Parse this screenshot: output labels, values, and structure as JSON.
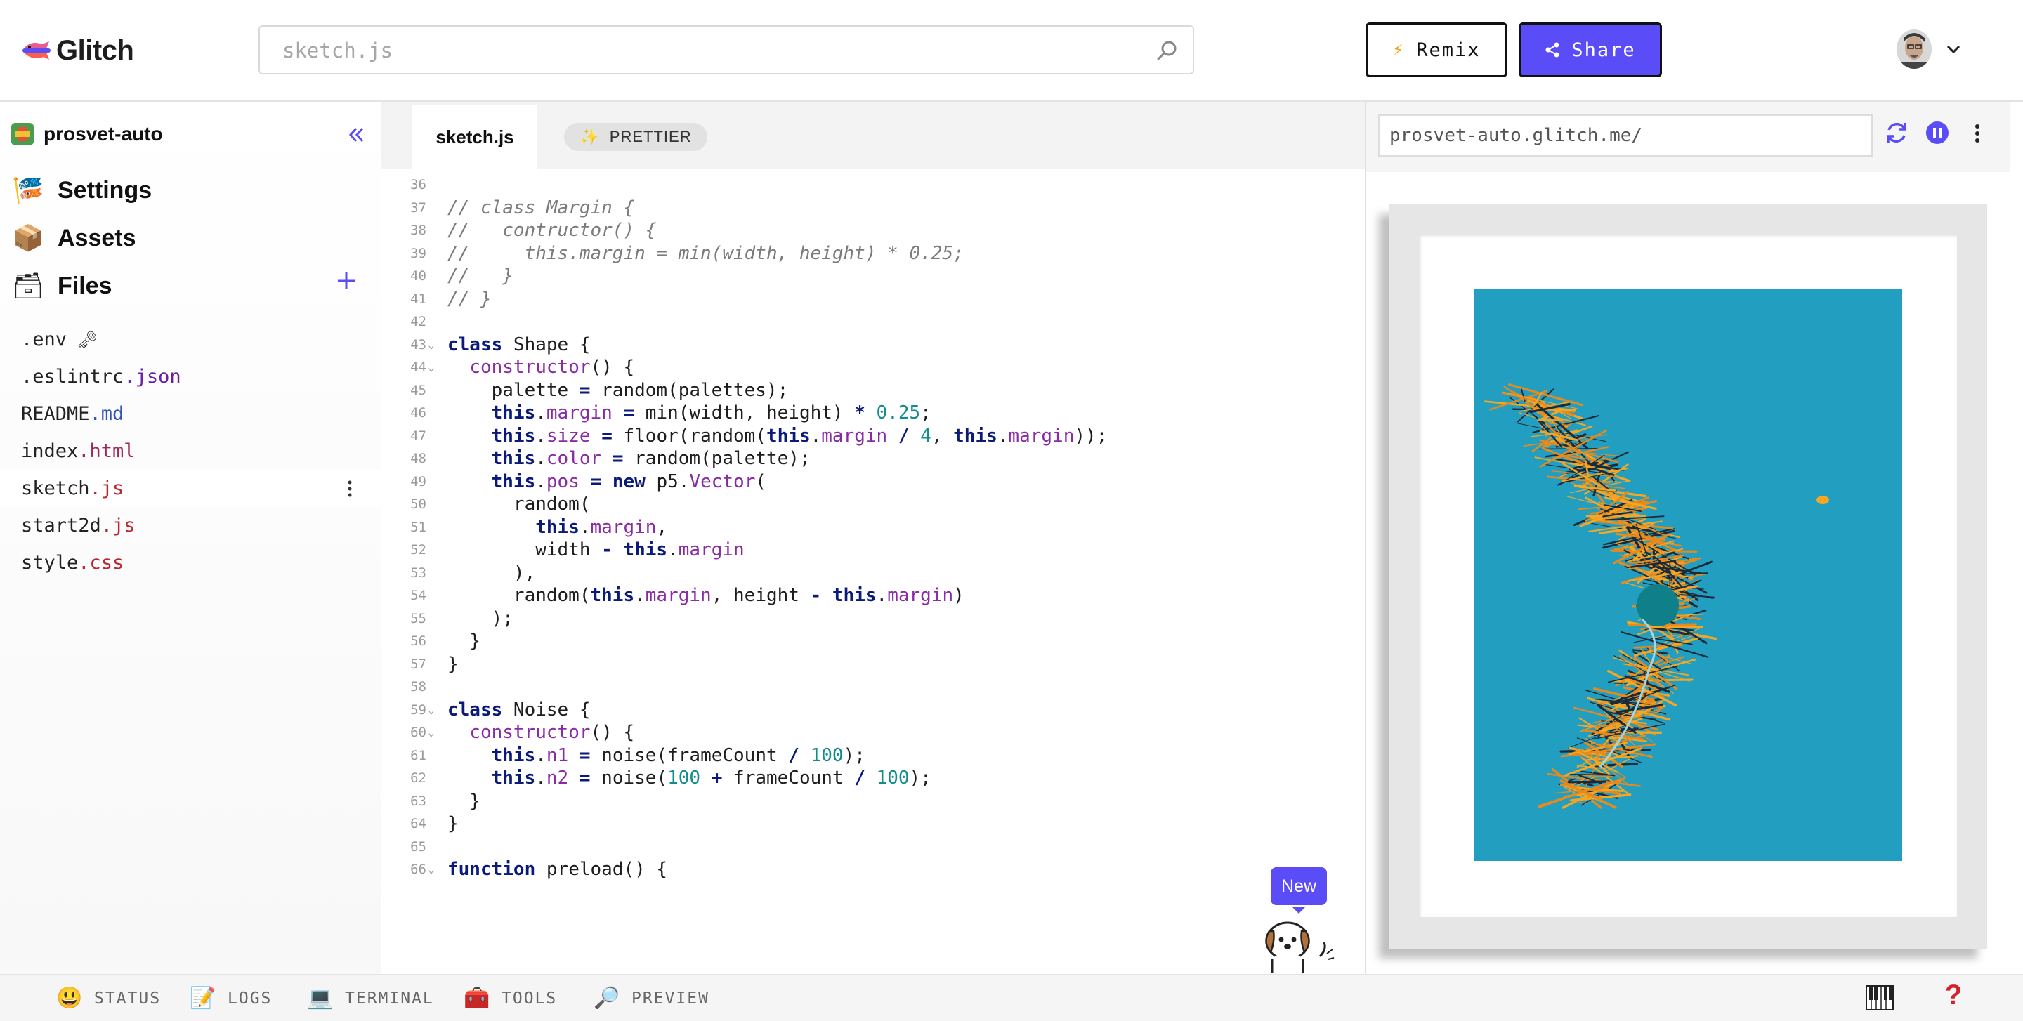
{
  "header": {
    "logo_text": "Glitch",
    "search_placeholder": "sketch.js",
    "remix_label": "Remix",
    "share_label": "Share",
    "accent_color": "#5a4cf7"
  },
  "sidebar": {
    "project_name": "prosvet-auto",
    "nav": [
      {
        "label": "Settings",
        "icon": "settings-emoji-icon"
      },
      {
        "label": "Assets",
        "icon": "package-icon"
      },
      {
        "label": "Files",
        "icon": "file-cabinet-icon"
      }
    ],
    "files": [
      {
        "base": ".env",
        "ext": "",
        "extra": "🗝"
      },
      {
        "base": ".eslintrc",
        "ext": ".json"
      },
      {
        "base": "README",
        "ext": ".md"
      },
      {
        "base": "index",
        "ext": ".html"
      },
      {
        "base": "sketch",
        "ext": ".js",
        "active": true
      },
      {
        "base": "start2d",
        "ext": ".js"
      },
      {
        "base": "style",
        "ext": ".css"
      }
    ]
  },
  "editor": {
    "active_tab": "sketch.js",
    "prettier_label": "PRETTIER",
    "lines": [
      {
        "n": "36",
        "fold": false,
        "tokens": []
      },
      {
        "n": "37",
        "fold": false,
        "tokens": [
          [
            "c",
            "// class Margin {"
          ]
        ]
      },
      {
        "n": "38",
        "fold": false,
        "tokens": [
          [
            "c",
            "//   contructor() {"
          ]
        ]
      },
      {
        "n": "39",
        "fold": false,
        "tokens": [
          [
            "c",
            "//     this.margin = min(width, height) * 0.25;"
          ]
        ]
      },
      {
        "n": "40",
        "fold": false,
        "tokens": [
          [
            "c",
            "//   }"
          ]
        ]
      },
      {
        "n": "41",
        "fold": false,
        "tokens": [
          [
            "c",
            "// }"
          ]
        ]
      },
      {
        "n": "42",
        "fold": false,
        "tokens": []
      },
      {
        "n": "43",
        "fold": true,
        "tokens": [
          [
            "k",
            "class"
          ],
          [
            "",
            " Shape {"
          ]
        ]
      },
      {
        "n": "44",
        "fold": true,
        "tokens": [
          [
            "",
            "  "
          ],
          [
            "p",
            "constructor"
          ],
          [
            "",
            "() {"
          ]
        ]
      },
      {
        "n": "45",
        "fold": false,
        "tokens": [
          [
            "",
            "    palette "
          ],
          [
            "o",
            "="
          ],
          [
            "",
            " random(palettes);"
          ]
        ]
      },
      {
        "n": "46",
        "fold": false,
        "tokens": [
          [
            "",
            "    "
          ],
          [
            "k",
            "this"
          ],
          [
            "",
            "."
          ],
          [
            "p",
            "margin"
          ],
          [
            "",
            " "
          ],
          [
            "o",
            "="
          ],
          [
            "",
            " min(width, height) "
          ],
          [
            "o",
            "*"
          ],
          [
            "",
            " "
          ],
          [
            "n",
            "0.25"
          ],
          [
            "",
            ";"
          ]
        ]
      },
      {
        "n": "47",
        "fold": false,
        "tokens": [
          [
            "",
            "    "
          ],
          [
            "k",
            "this"
          ],
          [
            "",
            "."
          ],
          [
            "p",
            "size"
          ],
          [
            "",
            " "
          ],
          [
            "o",
            "="
          ],
          [
            "",
            " floor(random("
          ],
          [
            "k",
            "this"
          ],
          [
            "",
            "."
          ],
          [
            "p",
            "margin"
          ],
          [
            "",
            " "
          ],
          [
            "o",
            "/"
          ],
          [
            "",
            " "
          ],
          [
            "n",
            "4"
          ],
          [
            "",
            ", "
          ],
          [
            "k",
            "this"
          ],
          [
            "",
            "."
          ],
          [
            "p",
            "margin"
          ],
          [
            "",
            "));"
          ]
        ]
      },
      {
        "n": "48",
        "fold": false,
        "tokens": [
          [
            "",
            "    "
          ],
          [
            "k",
            "this"
          ],
          [
            "",
            "."
          ],
          [
            "p",
            "color"
          ],
          [
            "",
            " "
          ],
          [
            "o",
            "="
          ],
          [
            "",
            " random(palette);"
          ]
        ]
      },
      {
        "n": "49",
        "fold": false,
        "tokens": [
          [
            "",
            "    "
          ],
          [
            "k",
            "this"
          ],
          [
            "",
            "."
          ],
          [
            "p",
            "pos"
          ],
          [
            "",
            " "
          ],
          [
            "o",
            "="
          ],
          [
            "",
            " "
          ],
          [
            "k",
            "new"
          ],
          [
            "",
            " p5."
          ],
          [
            "p",
            "Vector"
          ],
          [
            "",
            "("
          ]
        ]
      },
      {
        "n": "50",
        "fold": false,
        "tokens": [
          [
            "",
            "      random("
          ]
        ]
      },
      {
        "n": "51",
        "fold": false,
        "tokens": [
          [
            "",
            "        "
          ],
          [
            "k",
            "this"
          ],
          [
            "",
            "."
          ],
          [
            "p",
            "margin"
          ],
          [
            "",
            ","
          ]
        ]
      },
      {
        "n": "52",
        "fold": false,
        "tokens": [
          [
            "",
            "        width "
          ],
          [
            "o",
            "-"
          ],
          [
            "",
            " "
          ],
          [
            "k",
            "this"
          ],
          [
            "",
            "."
          ],
          [
            "p",
            "margin"
          ]
        ]
      },
      {
        "n": "53",
        "fold": false,
        "tokens": [
          [
            "",
            "      ),"
          ]
        ]
      },
      {
        "n": "54",
        "fold": false,
        "tokens": [
          [
            "",
            "      random("
          ],
          [
            "k",
            "this"
          ],
          [
            "",
            "."
          ],
          [
            "p",
            "margin"
          ],
          [
            "",
            ", height "
          ],
          [
            "o",
            "-"
          ],
          [
            "",
            " "
          ],
          [
            "k",
            "this"
          ],
          [
            "",
            "."
          ],
          [
            "p",
            "margin"
          ],
          [
            "",
            ")"
          ]
        ]
      },
      {
        "n": "55",
        "fold": false,
        "tokens": [
          [
            "",
            "    );"
          ]
        ]
      },
      {
        "n": "56",
        "fold": false,
        "tokens": [
          [
            "",
            "  }"
          ]
        ]
      },
      {
        "n": "57",
        "fold": false,
        "tokens": [
          [
            "",
            "}"
          ]
        ]
      },
      {
        "n": "58",
        "fold": false,
        "tokens": []
      },
      {
        "n": "59",
        "fold": true,
        "tokens": [
          [
            "k",
            "class"
          ],
          [
            "",
            " Noise {"
          ]
        ]
      },
      {
        "n": "60",
        "fold": true,
        "tokens": [
          [
            "",
            "  "
          ],
          [
            "p",
            "constructor"
          ],
          [
            "",
            "() {"
          ]
        ]
      },
      {
        "n": "61",
        "fold": false,
        "tokens": [
          [
            "",
            "    "
          ],
          [
            "k",
            "this"
          ],
          [
            "",
            "."
          ],
          [
            "p",
            "n1"
          ],
          [
            "",
            " "
          ],
          [
            "o",
            "="
          ],
          [
            "",
            " noise(frameCount "
          ],
          [
            "o",
            "/"
          ],
          [
            "",
            " "
          ],
          [
            "n",
            "100"
          ],
          [
            "",
            ");"
          ]
        ]
      },
      {
        "n": "62",
        "fold": false,
        "tokens": [
          [
            "",
            "    "
          ],
          [
            "k",
            "this"
          ],
          [
            "",
            "."
          ],
          [
            "p",
            "n2"
          ],
          [
            "",
            " "
          ],
          [
            "o",
            "="
          ],
          [
            "",
            " noise("
          ],
          [
            "n",
            "100"
          ],
          [
            "",
            " "
          ],
          [
            "o",
            "+"
          ],
          [
            "",
            " frameCount "
          ],
          [
            "o",
            "/"
          ],
          [
            "",
            " "
          ],
          [
            "n",
            "100"
          ],
          [
            "",
            ");"
          ]
        ]
      },
      {
        "n": "63",
        "fold": false,
        "tokens": [
          [
            "",
            "  }"
          ]
        ]
      },
      {
        "n": "64",
        "fold": false,
        "tokens": [
          [
            "",
            "}"
          ]
        ]
      },
      {
        "n": "65",
        "fold": false,
        "tokens": []
      },
      {
        "n": "66",
        "fold": true,
        "tokens": [
          [
            "k",
            "function"
          ],
          [
            "",
            " preload() {"
          ]
        ]
      }
    ],
    "new_badge": "New"
  },
  "preview": {
    "url": "prosvet-auto.glitch.me/",
    "artwork_bg": "#229fc0",
    "stroke_colors": [
      "#f5a623",
      "#e8891c",
      "#1b2a3a",
      "#9fd6e8",
      "#0f7f8a"
    ]
  },
  "footer": {
    "items": [
      {
        "label": "STATUS",
        "icon": "smiley-icon"
      },
      {
        "label": "LOGS",
        "icon": "memo-icon"
      },
      {
        "label": "TERMINAL",
        "icon": "laptop-icon"
      },
      {
        "label": "TOOLS",
        "icon": "toolbox-icon"
      },
      {
        "label": "PREVIEW",
        "icon": "magnifier-icon"
      }
    ],
    "help": "?"
  }
}
